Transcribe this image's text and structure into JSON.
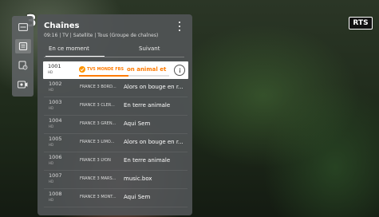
{
  "overlay": {
    "left_channel_mark": "3",
    "corner_logo": "RTS"
  },
  "side_rail": {
    "items": [
      {
        "icon": "tv-guide-icon"
      },
      {
        "icon": "channel-list-icon",
        "active": true
      },
      {
        "icon": "schedule-icon"
      },
      {
        "icon": "recordings-icon"
      }
    ]
  },
  "panel": {
    "title": "Chaînes",
    "subtitle": "09:16 | TV | Satellite | Tous (Groupe de chaînes)",
    "tabs": [
      "En ce moment",
      "Suivant"
    ]
  },
  "channels": [
    {
      "number": "1001",
      "hd": "HD",
      "name": "TV5 MONDE FBS",
      "program": "on animal et mo",
      "selected": true,
      "progress": 0.55
    },
    {
      "number": "1002",
      "hd": "HD",
      "name": "FRANCE 3 BORD...",
      "program": "Alors on bouge en r..."
    },
    {
      "number": "1003",
      "hd": "HD",
      "name": "FRANCE 3 CLER...",
      "program": "En terre animale"
    },
    {
      "number": "1004",
      "hd": "HD",
      "name": "FRANCE 3 GREN...",
      "program": "Aqui Sem"
    },
    {
      "number": "1005",
      "hd": "HD",
      "name": "FRANCE 3 LIMO...",
      "program": "Alors on bouge en r..."
    },
    {
      "number": "1006",
      "hd": "HD",
      "name": "FRANCE 3 LYON",
      "program": "En terre animale"
    },
    {
      "number": "1007",
      "hd": "HD",
      "name": "FRANCE 3 MARS...",
      "program": "music.box"
    },
    {
      "number": "1008",
      "hd": "HD",
      "name": "FRANCE 3 MONT...",
      "program": "Aqui Sem"
    }
  ]
}
